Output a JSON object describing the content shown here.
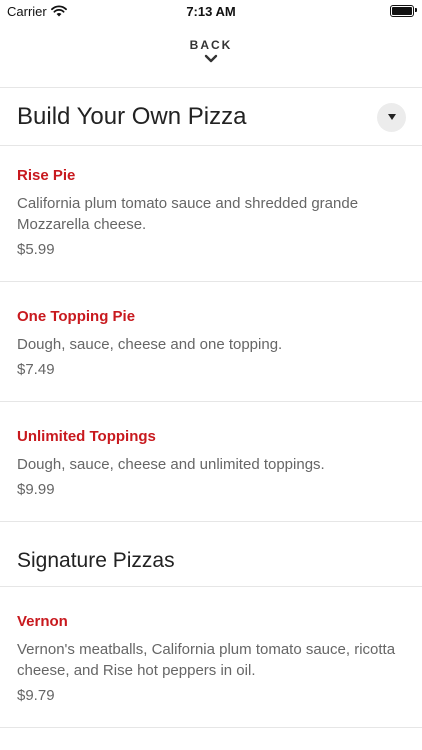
{
  "status_bar": {
    "carrier": "Carrier",
    "time": "7:13 AM"
  },
  "nav": {
    "back_label": "BACK"
  },
  "sections": [
    {
      "title": "Build Your Own Pizza",
      "items": [
        {
          "name": "Rise Pie",
          "description": "California plum tomato sauce and shredded grande Mozzarella cheese.",
          "price": "$5.99"
        },
        {
          "name": "One Topping Pie",
          "description": "Dough, sauce, cheese and one topping.",
          "price": "$7.49"
        },
        {
          "name": "Unlimited Toppings",
          "description": "Dough, sauce, cheese and unlimited toppings.",
          "price": "$9.99"
        }
      ]
    },
    {
      "title": "Signature Pizzas",
      "items": [
        {
          "name": "Vernon",
          "description": "Vernon's meatballs, California plum tomato sauce, ricotta cheese, and Rise hot peppers in oil.",
          "price": "$9.79"
        }
      ]
    }
  ],
  "colors": {
    "accent": "#c8191e",
    "text": "#666666",
    "divider": "#e6e6e6"
  }
}
